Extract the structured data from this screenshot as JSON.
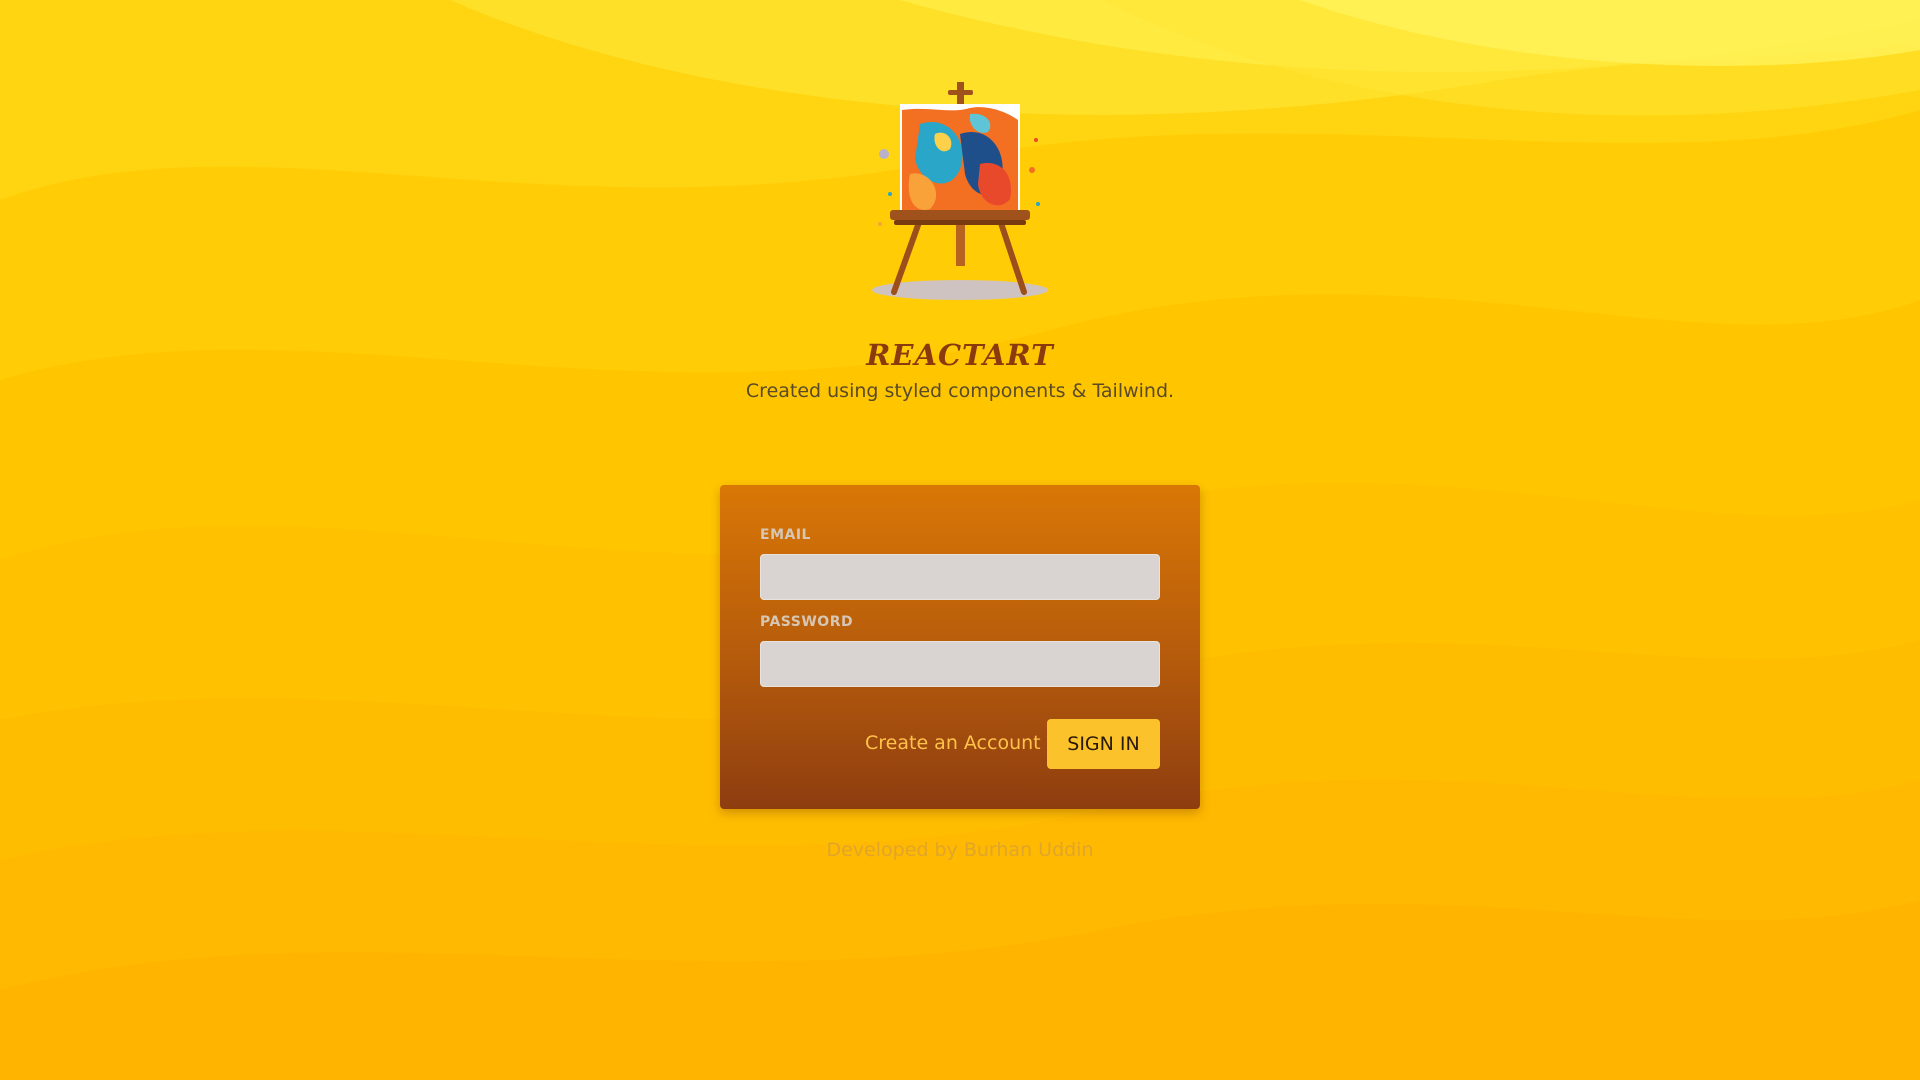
{
  "branding": {
    "app_name": "REACTART",
    "tagline": "Created using styled components & Tailwind."
  },
  "login_form": {
    "email_label": "EMAIL",
    "email_value": "",
    "password_label": "PASSWORD",
    "password_value": "",
    "create_account_label": "Create an Account",
    "sign_in_label": "SIGN IN"
  },
  "footer": {
    "credit": "Developed by Burhan Uddin"
  },
  "icons": {
    "logo": "easel-painting-icon"
  },
  "colors": {
    "background": "#ffc300",
    "card_top": "#d97706",
    "card_bottom": "#8e3d10",
    "button": "#fcc22c",
    "brand_text": "#8a3a0c",
    "link": "#ffc24a"
  }
}
